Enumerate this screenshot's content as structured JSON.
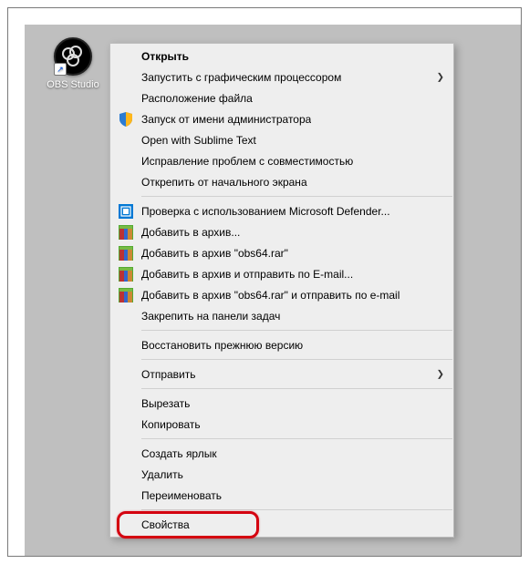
{
  "desktop": {
    "icon_label": "OBS Studio"
  },
  "menu": {
    "items": [
      {
        "label": "Открыть",
        "bold": true,
        "icon": null,
        "submenu": false
      },
      {
        "label": "Запустить с графическим процессором",
        "bold": false,
        "icon": null,
        "submenu": true
      },
      {
        "label": "Расположение файла",
        "bold": false,
        "icon": null,
        "submenu": false
      },
      {
        "label": "Запуск от имени администратора",
        "bold": false,
        "icon": "shield",
        "submenu": false
      },
      {
        "label": "Open with Sublime Text",
        "bold": false,
        "icon": null,
        "submenu": false
      },
      {
        "label": "Исправление проблем с совместимостью",
        "bold": false,
        "icon": null,
        "submenu": false
      },
      {
        "label": "Открепить от начального экрана",
        "bold": false,
        "icon": null,
        "submenu": false
      }
    ],
    "items2": [
      {
        "label": "Проверка с использованием Microsoft Defender...",
        "bold": false,
        "icon": "defender",
        "submenu": false
      },
      {
        "label": "Добавить в архив...",
        "bold": false,
        "icon": "rar",
        "submenu": false
      },
      {
        "label": "Добавить в архив \"obs64.rar\"",
        "bold": false,
        "icon": "rar",
        "submenu": false
      },
      {
        "label": "Добавить в архив и отправить по E-mail...",
        "bold": false,
        "icon": "rar",
        "submenu": false
      },
      {
        "label": "Добавить в архив \"obs64.rar\" и отправить по e-mail",
        "bold": false,
        "icon": "rar",
        "submenu": false
      },
      {
        "label": "Закрепить на панели задач",
        "bold": false,
        "icon": null,
        "submenu": false
      }
    ],
    "items3": [
      {
        "label": "Восстановить прежнюю версию",
        "bold": false,
        "icon": null,
        "submenu": false
      }
    ],
    "items4": [
      {
        "label": "Отправить",
        "bold": false,
        "icon": null,
        "submenu": true
      }
    ],
    "items5": [
      {
        "label": "Вырезать",
        "bold": false,
        "icon": null,
        "submenu": false
      },
      {
        "label": "Копировать",
        "bold": false,
        "icon": null,
        "submenu": false
      }
    ],
    "items6": [
      {
        "label": "Создать ярлык",
        "bold": false,
        "icon": null,
        "submenu": false
      },
      {
        "label": "Удалить",
        "bold": false,
        "icon": null,
        "submenu": false
      },
      {
        "label": "Переименовать",
        "bold": false,
        "icon": null,
        "submenu": false
      }
    ],
    "items7": [
      {
        "label": "Свойства",
        "bold": false,
        "icon": null,
        "submenu": false
      }
    ]
  },
  "highlight": {
    "target_label": "Свойства",
    "color": "#d4000f"
  }
}
